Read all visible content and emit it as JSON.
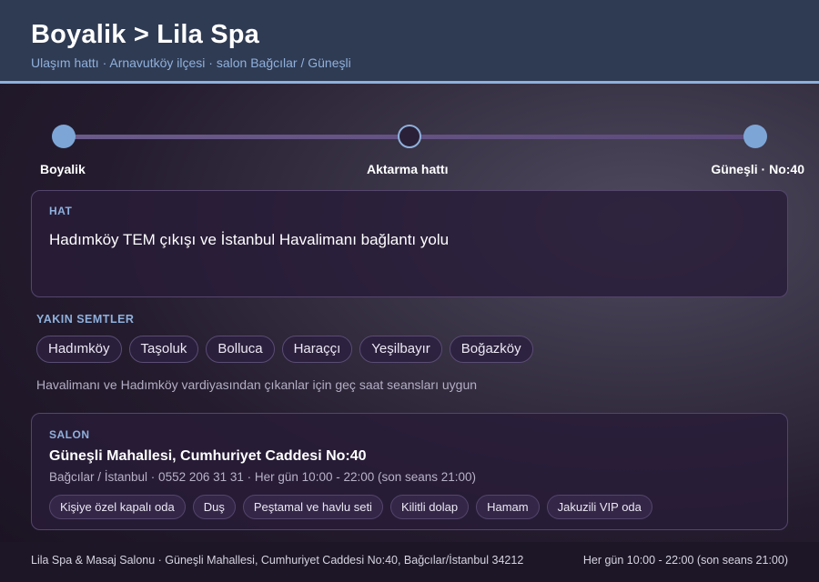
{
  "header": {
    "title": "Boyalik > Lila Spa",
    "subtitle": "Ulaşım hattı · Arnavutköy ilçesi · salon Bağcılar / Güneşli"
  },
  "route": {
    "stops": [
      {
        "label": "Boyalik",
        "style": "filled"
      },
      {
        "label": "Aktarma hattı",
        "style": "hollow"
      },
      {
        "label": "Güneşli · No:40",
        "style": "filled"
      }
    ]
  },
  "line_card": {
    "label": "HAT",
    "text": "Hadımköy TEM çıkışı ve İstanbul Havalimanı bağlantı yolu"
  },
  "nearby": {
    "label": "YAKIN SEMTLER",
    "items": [
      "Hadımköy",
      "Taşoluk",
      "Bolluca",
      "Haraççı",
      "Yeşilbayır",
      "Boğazköy"
    ],
    "note": "Havalimanı ve Hadımköy vardiyasından çıkanlar için geç saat seansları uygun"
  },
  "salon": {
    "label": "SALON",
    "address": "Güneşli Mahallesi, Cumhuriyet Caddesi No:40",
    "details": "Bağcılar / İstanbul · 0552 206 31 31 · Her gün 10:00 - 22:00 (son seans 21:00)",
    "amenities": [
      "Kişiye özel kapalı oda",
      "Duş",
      "Peştamal ve havlu seti",
      "Kilitli dolap",
      "Hamam",
      "Jakuzili VIP oda"
    ]
  },
  "footer": {
    "left": "Lila Spa & Masaj Salonu · Güneşli Mahallesi, Cumhuriyet Caddesi No:40, Bağcılar/İstanbul 34212",
    "right": "Her gün 10:00 - 22:00 (son seans 21:00)"
  },
  "colors": {
    "accent": "#8fb0dc",
    "header_bg": "#2f3b53",
    "stop_fill": "#7da6d6"
  }
}
